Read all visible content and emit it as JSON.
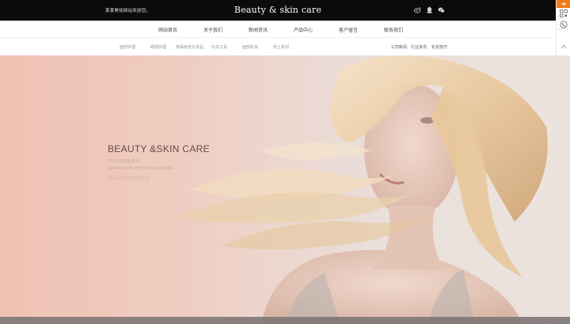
{
  "header": {
    "welcome": "某某美妆网站欢迎您。",
    "brand": "Beauty & skin care",
    "social_icons": [
      "weibo-icon",
      "qq-icon",
      "wechat-icon"
    ]
  },
  "main_nav": {
    "items": [
      "网站首页",
      "关于我们",
      "新闻资讯",
      "产品中心",
      "客户留言",
      "联系我们"
    ]
  },
  "sub_nav": {
    "left_items": [
      "面部护理",
      "眼部护理",
      "特殊用途化妆品",
      "化妆工具",
      "面部彩妆",
      "男士系列"
    ],
    "right_items": [
      "公司新闻",
      "行业资讯",
      "化妆技巧"
    ]
  },
  "sidebar": {
    "icons": [
      "arrow-icon",
      "qrcode-icon",
      "phone-icon",
      "back-to-top-icon"
    ]
  },
  "hero": {
    "title": "BEAUTY &SKIN CARE",
    "line1": "2019美妆新系列",
    "line2": "CARNATION WHITENING MASK",
    "cta": "开启肌肤焕颜的记忆"
  },
  "colors": {
    "topbar": "#0b0b0b",
    "accent": "#f07a1c",
    "hero_title": "#6a4a44",
    "hero_bg_left": "#efc2b3",
    "hero_bg_right": "#ece3df"
  }
}
